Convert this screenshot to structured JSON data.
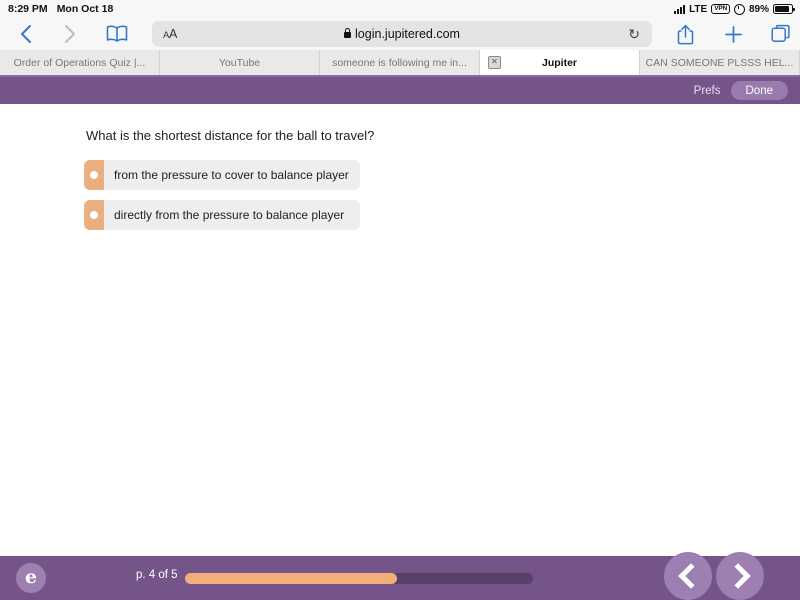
{
  "status_bar": {
    "time": "8:29 PM",
    "date": "Mon Oct 18",
    "signal_icon": "cellular-signal-icon",
    "network": "LTE",
    "vpn_badge": "VPN",
    "alarm_icon": "alarm-icon",
    "battery_percent": "89%",
    "battery_level": 89
  },
  "browser": {
    "back_icon": "chevron-left-icon",
    "forward_icon": "chevron-right-icon",
    "bookmarks_icon": "book-icon",
    "text_size_label": "AA",
    "lock_icon": "lock-icon",
    "url": "login.jupitered.com",
    "reload_icon": "reload-icon",
    "share_icon": "share-icon",
    "newtab_icon": "plus-icon",
    "tabs_icon": "tabs-overview-icon",
    "tabs": [
      {
        "title": "Order of Operations Quiz |...",
        "active": false,
        "has_close": false
      },
      {
        "title": "YouTube",
        "active": false,
        "has_close": false
      },
      {
        "title": "someone is following me in...",
        "active": false,
        "has_close": false
      },
      {
        "title": "Jupiter",
        "active": true,
        "has_close": true,
        "close_label": "✕"
      },
      {
        "title": "CAN SOMEONE PLSSS HEL...",
        "active": false,
        "has_close": false
      }
    ]
  },
  "app_header": {
    "prefs_label": "Prefs",
    "done_label": "Done",
    "bar_color": "#755589"
  },
  "quiz": {
    "question": "What is the shortest distance for the ball to travel?",
    "choices": [
      {
        "text": "from the pressure to cover to balance player",
        "selected": false
      },
      {
        "text": "directly from the pressure to balance player",
        "selected": false
      }
    ],
    "choice_handle_color": "#eaae7f"
  },
  "footer": {
    "logo_glyph": "e",
    "logo_name": "jupiter-logo",
    "page_indicator": "p. 4 of 5",
    "progress_percent": 61,
    "progress_fill_color": "#f1b079",
    "progress_track_color": "#584168",
    "prev_icon": "chevron-left-icon",
    "next_icon": "chevron-right-icon"
  }
}
